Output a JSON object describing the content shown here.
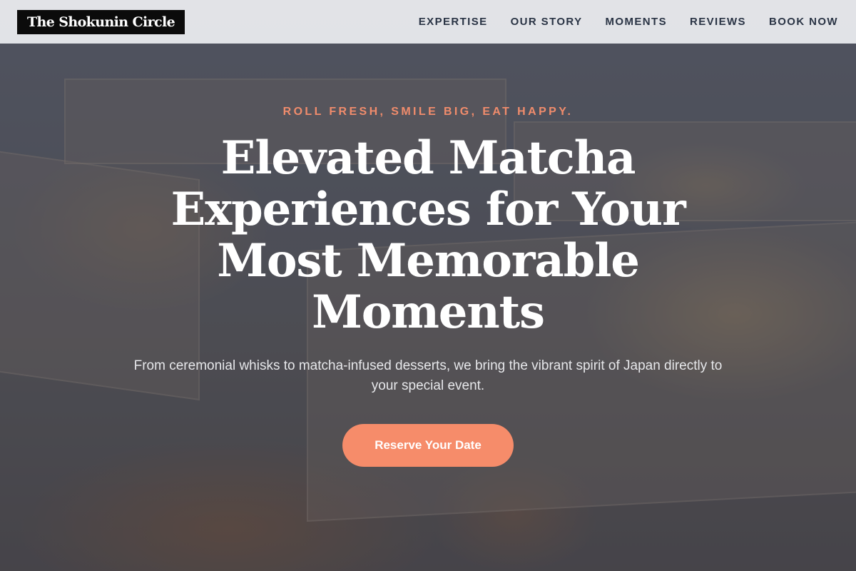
{
  "brand": {
    "logo_text": "The Shokunin Circle"
  },
  "nav": {
    "items": [
      {
        "label": "EXPERTISE"
      },
      {
        "label": "OUR STORY"
      },
      {
        "label": "MOMENTS"
      },
      {
        "label": "REVIEWS"
      },
      {
        "label": "BOOK NOW"
      }
    ]
  },
  "hero": {
    "tagline": "ROLL FRESH, SMILE BIG, EAT HAPPY.",
    "headline": "Elevated Matcha Experiences for Your Most Memorable Moments",
    "subtext": "From ceremonial whisks to matcha-infused desserts, we bring the vibrant spirit of Japan directly to your special event.",
    "cta_label": "Reserve Your Date"
  },
  "colors": {
    "accent": "#f68c6a",
    "nav_text": "#2a3445",
    "logo_bg": "#0b0b0b"
  }
}
